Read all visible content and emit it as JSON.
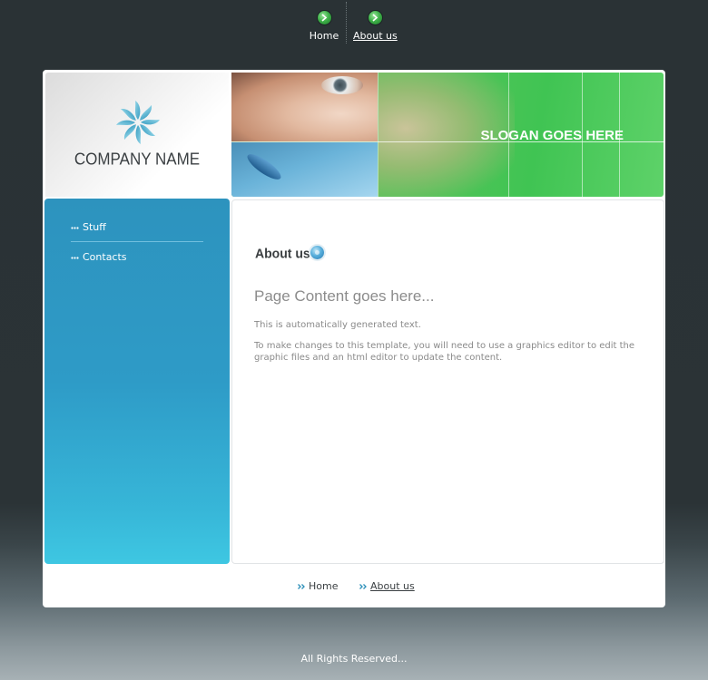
{
  "top_nav": {
    "items": [
      {
        "label": "Home",
        "active": false
      },
      {
        "label": "About us",
        "active": true
      }
    ]
  },
  "header": {
    "company_name": "COMPANY NAME",
    "slogan": "SLOGAN GOES HERE"
  },
  "sidebar": {
    "items": [
      {
        "label": "Stuff"
      },
      {
        "label": "Contacts"
      }
    ]
  },
  "content": {
    "heading": "About us",
    "page_title": "Page Content goes here...",
    "paragraphs": [
      "This is automatically generated text.",
      "To make changes to this template, you will need to use a graphics editor to edit the graphic files and an html editor to update the content."
    ]
  },
  "footer": {
    "links": [
      {
        "label": "Home"
      },
      {
        "label": "About us"
      }
    ],
    "copyright": "All Rights Reserved..."
  },
  "colors": {
    "background": "#2a3235",
    "sidebar": "#2e9bc7",
    "banner_green": "#40c453",
    "nav_bullet_green": "#3fb24a",
    "text_dark": "#3a3f42",
    "text_muted": "#8a8a8a"
  },
  "icons": {
    "logo": "pinwheel-logo-icon",
    "nav_bullet": "green-arrow-bullet-icon",
    "sidebar_bullet": "triple-dot-bullet-icon",
    "heading": "blue-orb-icon",
    "footer_bullet": "double-chevron-icon"
  }
}
